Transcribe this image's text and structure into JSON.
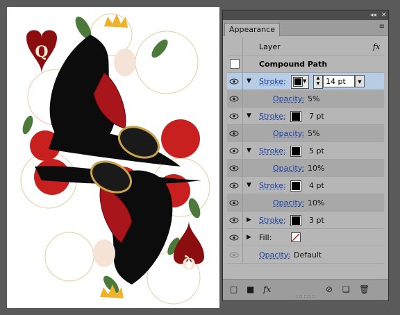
{
  "panel": {
    "tab_label": "Appearance",
    "collapse_glyph": "◂◂",
    "close_glyph": "✕",
    "menu_glyph": "≡"
  },
  "rows": {
    "layer": {
      "label": "Layer",
      "fx": "fx"
    },
    "compound": {
      "label": "Compound Path"
    },
    "stroke1": {
      "label": "Stroke:",
      "weight": "14 pt"
    },
    "opacity1": {
      "label": "Opacity:",
      "value": "5%"
    },
    "stroke2": {
      "label": "Stroke:",
      "weight": "7 pt"
    },
    "opacity2": {
      "label": "Opacity:",
      "value": "5%"
    },
    "stroke3": {
      "label": "Stroke:",
      "weight": "5 pt"
    },
    "opacity3": {
      "label": "Opacity:",
      "value": "10%"
    },
    "stroke4": {
      "label": "Stroke:",
      "weight": "4 pt"
    },
    "opacity4": {
      "label": "Opacity:",
      "value": "10%"
    },
    "stroke5": {
      "label": "Stroke:",
      "weight": "3 pt"
    },
    "fill": {
      "label": "Fill:"
    },
    "opacity_default": {
      "label": "Opacity:",
      "value": "Default"
    }
  },
  "bottom": {
    "fx_label": "fx"
  },
  "art": {
    "card_letter_top": "Q",
    "card_letter_bottom": "Q"
  },
  "colors": {
    "selected_row": "#b7cde6",
    "link": "#1a3fa0",
    "card_red": "#8a0d10"
  }
}
